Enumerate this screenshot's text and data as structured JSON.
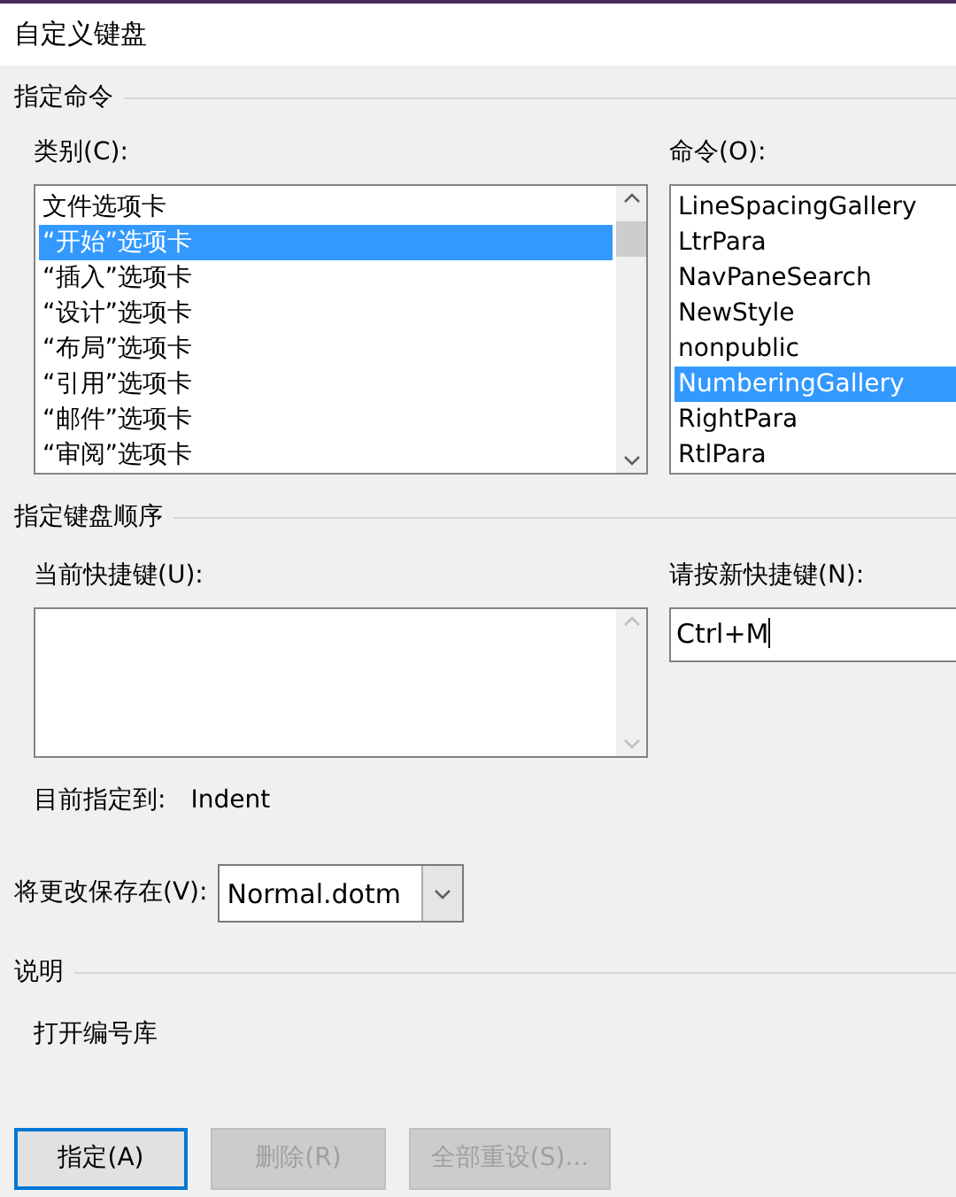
{
  "window": {
    "title": "自定义键盘"
  },
  "commands_group": {
    "title": "指定命令",
    "categories": {
      "label": "类别(C):",
      "items": [
        {
          "text": "文件选项卡",
          "selected": false
        },
        {
          "text": "“开始”选项卡",
          "selected": true
        },
        {
          "text": "“插入”选项卡",
          "selected": false
        },
        {
          "text": "“设计”选项卡",
          "selected": false
        },
        {
          "text": "“布局”选项卡",
          "selected": false
        },
        {
          "text": "“引用”选项卡",
          "selected": false
        },
        {
          "text": "“邮件”选项卡",
          "selected": false
        },
        {
          "text": "“审阅”选项卡",
          "selected": false
        }
      ]
    },
    "commands": {
      "label": "命令(O):",
      "items": [
        {
          "text": "LineSpacingGallery",
          "selected": false
        },
        {
          "text": "LtrPara",
          "selected": false
        },
        {
          "text": "NavPaneSearch",
          "selected": false
        },
        {
          "text": "NewStyle",
          "selected": false
        },
        {
          "text": "nonpublic",
          "selected": false
        },
        {
          "text": "NumberingGallery",
          "selected": true
        },
        {
          "text": "RightPara",
          "selected": false
        },
        {
          "text": "RtlPara",
          "selected": false
        }
      ]
    }
  },
  "shortcut_group": {
    "title": "指定键盘顺序",
    "current_keys": {
      "label": "当前快捷键(U):"
    },
    "new_key": {
      "label": "请按新快捷键(N):",
      "value": "Ctrl+M"
    },
    "assigned_label": "目前指定到:",
    "assigned_value": "Indent"
  },
  "save_in": {
    "label": "将更改保存在(V):",
    "value": "Normal.dotm"
  },
  "description": {
    "title": "说明",
    "text": "打开编号库"
  },
  "buttons": [
    {
      "label": "指定(A)",
      "disabled": false,
      "default": true
    },
    {
      "label": "删除(R)",
      "disabled": true,
      "default": false
    },
    {
      "label": "全部重设(S)...",
      "disabled": true,
      "default": false
    }
  ]
}
